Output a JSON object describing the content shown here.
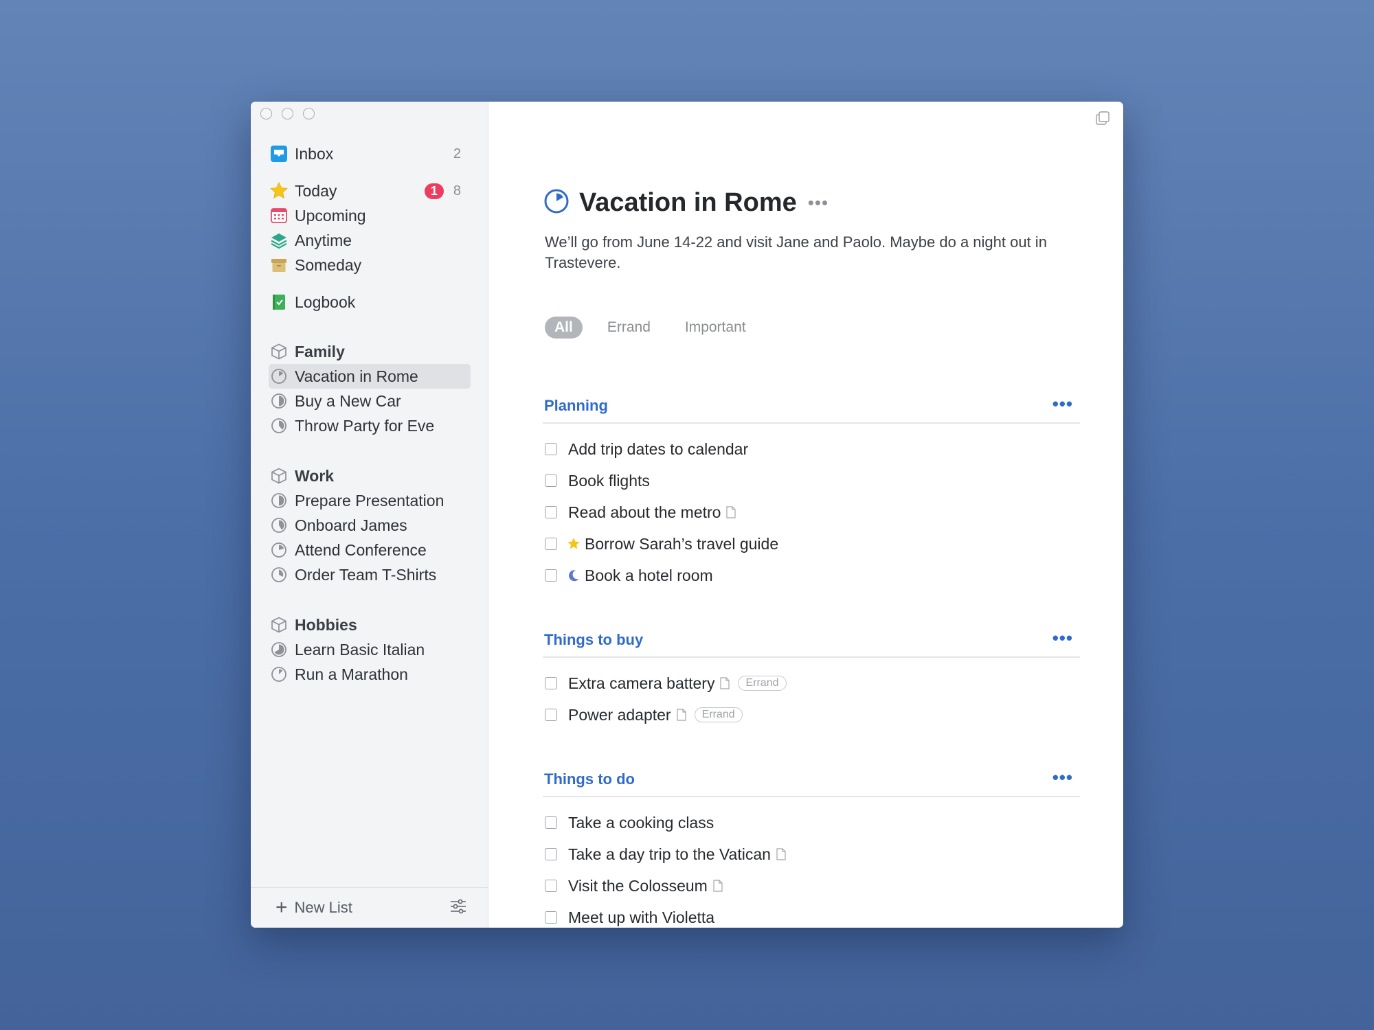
{
  "sidebar": {
    "inbox": {
      "label": "Inbox",
      "count": "2"
    },
    "today": {
      "label": "Today",
      "badge": "1",
      "count": "8"
    },
    "upcoming": {
      "label": "Upcoming"
    },
    "anytime": {
      "label": "Anytime"
    },
    "someday": {
      "label": "Someday"
    },
    "logbook": {
      "label": "Logbook"
    },
    "areas": [
      {
        "label": "Family",
        "projects": [
          "Vacation in Rome",
          "Buy a New Car",
          "Throw Party for Eve"
        ]
      },
      {
        "label": "Work",
        "projects": [
          "Prepare Presentation",
          "Onboard James",
          "Attend Conference",
          "Order Team T-Shirts"
        ]
      },
      {
        "label": "Hobbies",
        "projects": [
          "Learn Basic Italian",
          "Run a Marathon"
        ]
      }
    ],
    "selected_project": "Vacation in Rome",
    "new_list_label": "New List"
  },
  "project": {
    "title": "Vacation in Rome",
    "more": "•••",
    "notes": "We’ll go from June 14-22 and visit Jane and Paolo. Maybe do a night out in Trastevere.",
    "tags": [
      "All",
      "Errand",
      "Important"
    ],
    "active_tag": "All"
  },
  "headings": [
    {
      "title": "Planning",
      "more": "•••",
      "todos": [
        {
          "text": "Add trip dates to calendar"
        },
        {
          "text": "Book flights"
        },
        {
          "text": "Read about the metro",
          "note": true
        },
        {
          "text": "Borrow Sarah’s travel guide",
          "prefix": "star-icon"
        },
        {
          "text": "Book a hotel room",
          "prefix": "moon-icon"
        }
      ]
    },
    {
      "title": "Things to buy",
      "more": "•••",
      "todos": [
        {
          "text": "Extra camera battery",
          "note": true,
          "tag": "Errand"
        },
        {
          "text": "Power adapter",
          "note": true,
          "tag": "Errand"
        }
      ]
    },
    {
      "title": "Things to do",
      "more": "•••",
      "todos": [
        {
          "text": "Take a cooking class"
        },
        {
          "text": "Take a day trip to the Vatican",
          "note": true
        },
        {
          "text": "Visit the Colosseum",
          "note": true
        },
        {
          "text": "Meet up with Violetta"
        }
      ]
    }
  ],
  "colors": {
    "accent": "#2f6cc9",
    "badge": "#ec3c5f",
    "today_star": "#f5c518",
    "evening_moon": "#5b77d6"
  }
}
